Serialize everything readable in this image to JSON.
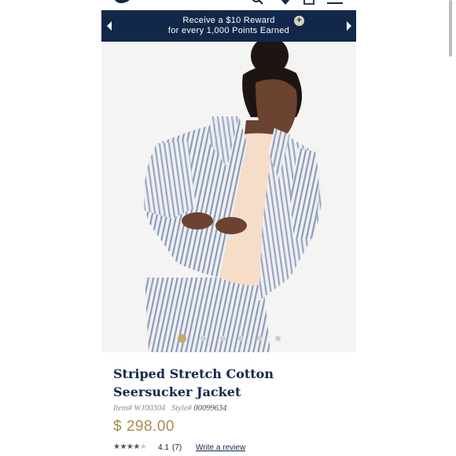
{
  "promo": {
    "line1": "Receive a $10 Reward",
    "line2": "for every 1,000 Points Earned",
    "background": "#12284a",
    "badge_symbol": "+"
  },
  "nav": {
    "icons": [
      "logo-whale-icon",
      "search-icon",
      "heart-icon",
      "shopping-bag-icon",
      "menu-icon"
    ]
  },
  "carousel": {
    "slide_count": 6,
    "active_index": 0,
    "active_color": "#c5a869"
  },
  "product": {
    "title": "Striped Stretch Cotton Seersucker Jacket",
    "item_label": "Item#",
    "item_number": "WJ00304",
    "style_label": "Style#",
    "style_number": "00099634",
    "price": "$ 298.00",
    "stars_filled": "★★★★",
    "stars_empty": "★",
    "rating": "4.1",
    "review_count": "(7)",
    "write_review": "Write a review"
  }
}
